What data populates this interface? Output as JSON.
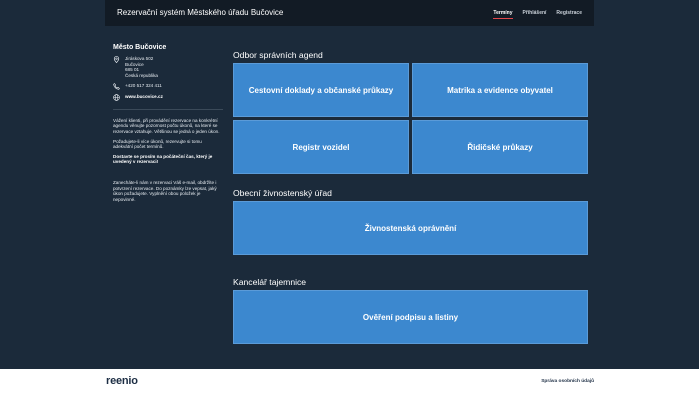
{
  "header": {
    "title": "Rezervační systém Městského úřadu Bučovice",
    "nav": [
      "Termíny",
      "Přihlášení",
      "Registrace"
    ],
    "active_nav": "Termíny",
    "accent_color": "#e2474c"
  },
  "sidebar": {
    "city": "Město Bučovice",
    "address": [
      "Jiráskova 502",
      "Bučovice",
      "685 01",
      "Česká republika"
    ],
    "phone": "+420 517 324 411",
    "website": "www.bucovice.cz",
    "icons": [
      "location-pin-icon",
      "phone-icon",
      "globe-icon"
    ],
    "notes": {
      "p1": "Vážení klienti, při provádění rezervace na konkrétní agendu věnujte pozornost počtu úkonů, na které se rezervace vztahuje. Většinou se jedná o jeden úkon.",
      "p2": "Požadujete-li více úkonů, rezervujte si tomu adekvátní počet termínů.",
      "p3": "Dostavte se prosím na počáteční čas, který je uvedený v rezervaci!",
      "p4": "Zanecháte-li nám v rezervaci Váš e-mail, obdržíte i potvrzení rezervace. Do poznámky lze vepsat, jaký úkon požadujete. Vyplnění obou položek je nepovinné."
    }
  },
  "sections": [
    {
      "title": "Odbor správních agend",
      "tiles": [
        "Cestovní doklady a občanské průkazy",
        "Matrika a evidence obyvatel",
        "Registr vozidel",
        "Řidičské průkazy"
      ]
    },
    {
      "title": "Obecní živnostenský úřad",
      "tiles": [
        "Živnostenská oprávnění"
      ]
    },
    {
      "title": "Kancelář tajemnice",
      "tiles": [
        "Ověření podpisu a listiny"
      ]
    }
  ],
  "footer": {
    "logo": "reenio",
    "privacy": "Správa osobních údajů"
  },
  "colors": {
    "background": "#1b2a3a",
    "header": "#121b25",
    "tile": "#3c88cf"
  }
}
